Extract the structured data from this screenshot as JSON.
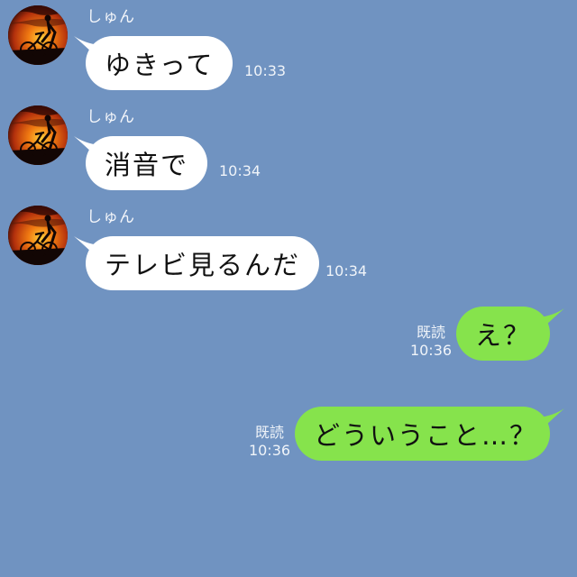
{
  "chat": {
    "background_color": "#7093c1",
    "incoming_bubble_color": "#ffffff",
    "outgoing_bubble_color": "#86e34c",
    "messages": [
      {
        "direction": "incoming",
        "sender": "しゅん",
        "avatar": "sunset-bicycle-avatar",
        "text": "ゆきって",
        "time": "10:33"
      },
      {
        "direction": "incoming",
        "sender": "しゅん",
        "avatar": "sunset-bicycle-avatar",
        "text": "消音で",
        "time": "10:34"
      },
      {
        "direction": "incoming",
        "sender": "しゅん",
        "avatar": "sunset-bicycle-avatar",
        "text": "テレビ見るんだ",
        "time": "10:34"
      },
      {
        "direction": "outgoing",
        "read_status": "既読",
        "text": "え？",
        "time": "10:36"
      },
      {
        "direction": "outgoing",
        "read_status": "既読",
        "text": "どういうこと…？",
        "time": "10:36"
      }
    ]
  }
}
